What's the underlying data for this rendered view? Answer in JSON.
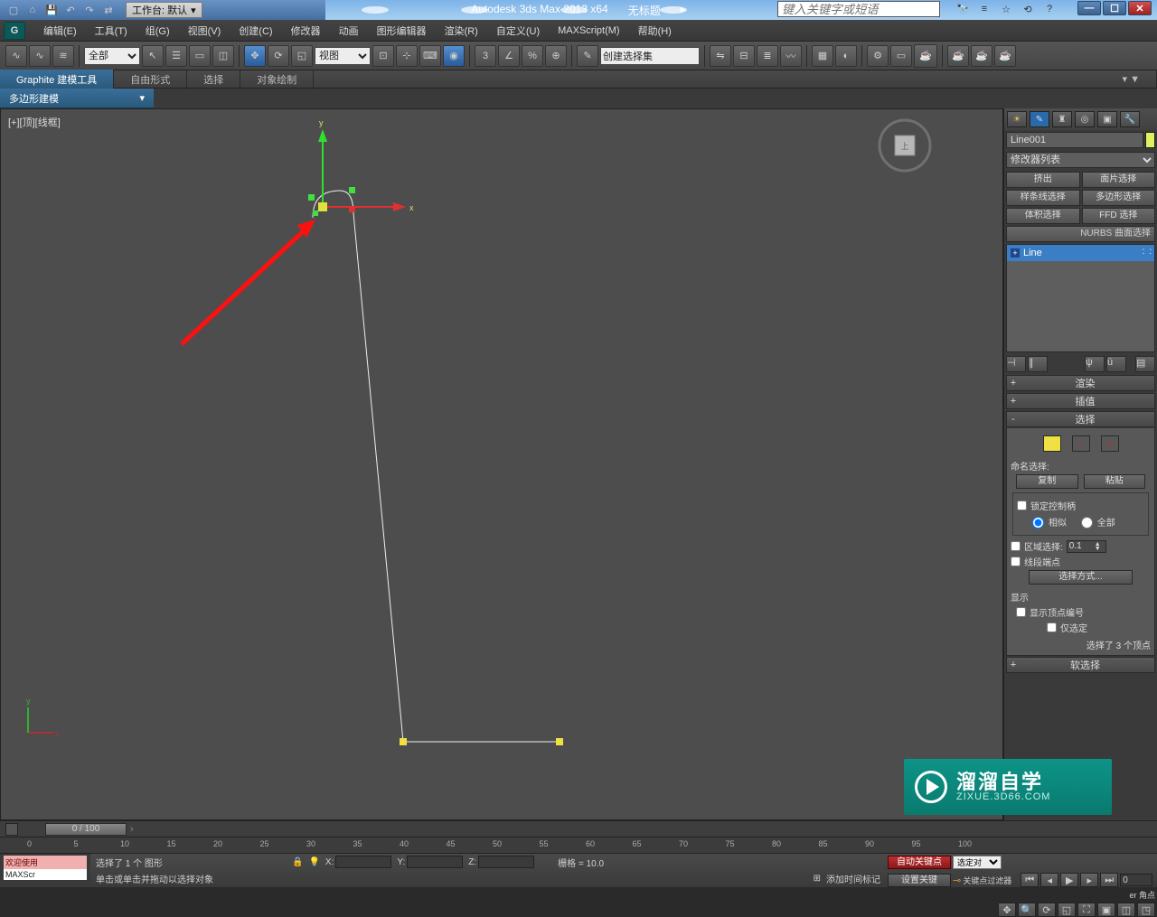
{
  "titlebar": {
    "workspace_label": "工作台: 默认",
    "app": "Autodesk 3ds Max  2013 x64",
    "doc": "无标题",
    "search_placeholder": "键入关键字或短语"
  },
  "menus": [
    "编辑(E)",
    "工具(T)",
    "组(G)",
    "视图(V)",
    "创建(C)",
    "修改器",
    "动画",
    "图形编辑器",
    "渲染(R)",
    "自定义(U)",
    "MAXScript(M)",
    "帮助(H)"
  ],
  "toolbar": {
    "filter": "全部",
    "ref": "视图",
    "namedset": "创建选择集"
  },
  "ribbon": {
    "tabs": [
      "Graphite 建模工具",
      "自由形式",
      "选择",
      "对象绘制"
    ],
    "subtab": "多边形建模"
  },
  "viewport": {
    "label": "[+][顶][线框]",
    "axis_x": "x",
    "axis_y": "y"
  },
  "side": {
    "object": "Line001",
    "modlist": "修改器列表",
    "btns": [
      "挤出",
      "面片选择",
      "样条线选择",
      "多边形选择",
      "体积选择",
      "FFD 选择"
    ],
    "nurbs": "NURBS 曲面选择",
    "stack": "Line",
    "rollouts": {
      "render": "渲染",
      "interp": "插值",
      "sel": "选择",
      "soft": "软选择"
    },
    "sel": {
      "named": "命名选择:",
      "copy": "复制",
      "paste": "粘贴",
      "lock": "锁定控制柄",
      "similar": "相似",
      "all": "全部",
      "area": "区域选择:",
      "area_val": "0.1",
      "seg": "线段端点",
      "method": "选择方式...",
      "display": "显示",
      "shownum": "显示顶点编号",
      "onlysel": "仅选定",
      "status": "选择了 3 个顶点"
    }
  },
  "time": {
    "knob": "0 / 100",
    "ticks": [
      "0",
      "5",
      "10",
      "15",
      "20",
      "25",
      "30",
      "35",
      "40",
      "45",
      "50",
      "55",
      "60",
      "65",
      "70",
      "75",
      "80",
      "85",
      "90",
      "95",
      "100"
    ]
  },
  "status": {
    "welcome": "欢迎使用",
    "maxscr": "MAXScr",
    "selected": "选择了 1 个 图形",
    "hint": "单击或单击并拖动以选择对象",
    "x": "X:",
    "y": "Y:",
    "z": "Z:",
    "grid": "栅格 = 10.0",
    "addmarker": "添加时间标记",
    "autokey": "自动关键点",
    "setkey": "设置关键",
    "keyfilter": "关键点过滤器",
    "seldrop": "选定对",
    "corner": "er 角点"
  },
  "watermark": {
    "line1": "溜溜自学",
    "line2": "ZIXUE.3D66.COM"
  }
}
